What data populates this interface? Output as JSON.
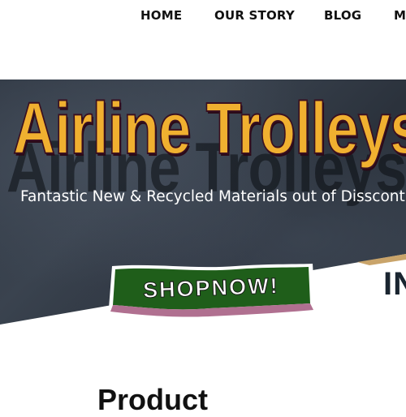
{
  "nav": {
    "items": [
      {
        "label": "HOME"
      },
      {
        "label": "OUR STORY"
      },
      {
        "label": "BLOG"
      },
      {
        "label": "M"
      }
    ]
  },
  "hero": {
    "title": "Airline Trolleys",
    "subtitle": "Fantastic New & Recycled Materials out of Dissconti",
    "cta_label": "SHOPNOW!",
    "partial_logo_text": "IN",
    "colors": {
      "title": "#f0b030",
      "banner_green": "#1f5e1a",
      "background": "#333b46"
    }
  },
  "section": {
    "heading": "Product"
  }
}
